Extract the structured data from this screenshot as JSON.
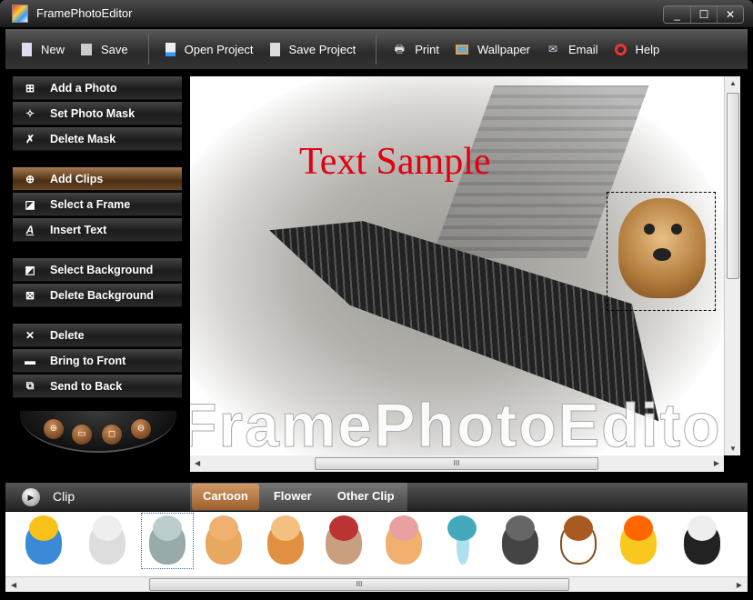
{
  "window": {
    "title": "FramePhotoEditor",
    "controls": [
      "_",
      "☐",
      "✕"
    ]
  },
  "toolbar": {
    "items": [
      {
        "label": "New",
        "icon": "new-file-icon"
      },
      {
        "label": "Save",
        "icon": "save-icon"
      },
      {
        "label": "Open Project",
        "icon": "open-project-icon"
      },
      {
        "label": "Save Project",
        "icon": "save-project-icon"
      },
      {
        "label": "Print",
        "icon": "print-icon"
      },
      {
        "label": "Wallpaper",
        "icon": "wallpaper-icon"
      },
      {
        "label": "Email",
        "icon": "email-icon"
      },
      {
        "label": "Help",
        "icon": "help-icon"
      }
    ]
  },
  "sidebar": {
    "items": [
      {
        "label": "Add a Photo"
      },
      {
        "label": "Set Photo Mask"
      },
      {
        "label": "Delete Mask"
      },
      {
        "label": "Add Clips",
        "active": true
      },
      {
        "label": "Select a Frame"
      },
      {
        "label": "Insert Text"
      },
      {
        "label": "Select Background"
      },
      {
        "label": "Delete Background"
      },
      {
        "label": "Delete"
      },
      {
        "label": "Bring to Front"
      },
      {
        "label": "Send to Back"
      }
    ]
  },
  "canvas": {
    "text_sample": "Text Sample",
    "text_color": "#e00010",
    "watermark": "FramePhotoEditor"
  },
  "clip": {
    "label": "Clip",
    "tabs": [
      {
        "label": "Cartoon",
        "active": true
      },
      {
        "label": "Flower"
      },
      {
        "label": "Other Clip"
      }
    ]
  },
  "scroll": {
    "grip": "III"
  }
}
